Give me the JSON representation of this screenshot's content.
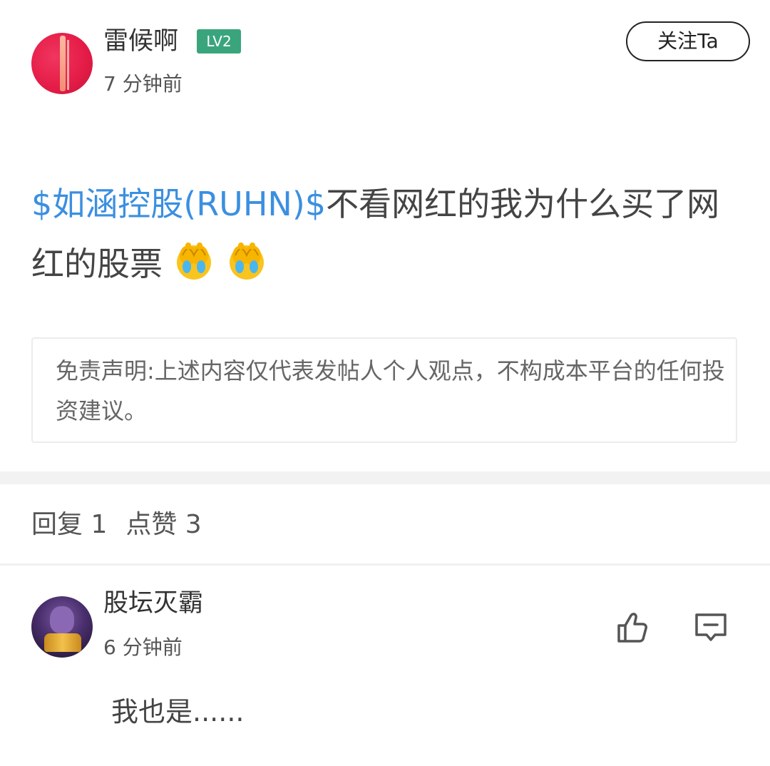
{
  "post": {
    "author": "雷候啊",
    "level": "LV2",
    "time": "7 分钟前",
    "follow_label": "关注Ta",
    "stock_tag": "$如涵控股(RUHN)$",
    "text": "不看网红的我为什么买了网红的股票",
    "emojis": [
      "facepalm-crying-emoji",
      "facepalm-crying-emoji"
    ]
  },
  "disclaimer": {
    "text": "免责声明:上述内容仅代表发帖人个人观点，不构成本平台的任何投资建议。"
  },
  "stats": {
    "replies": "回复 1",
    "likes": "点赞 3"
  },
  "comment": {
    "author": "股坛灭霸",
    "time": "6 分钟前",
    "text": "我也是......",
    "icons": [
      "thumbs-up-icon",
      "comment-icon"
    ]
  },
  "colors": {
    "stock_link": "#3b8fe0",
    "level_badge": "#3aa57c",
    "divider": "#f2f2f2"
  }
}
